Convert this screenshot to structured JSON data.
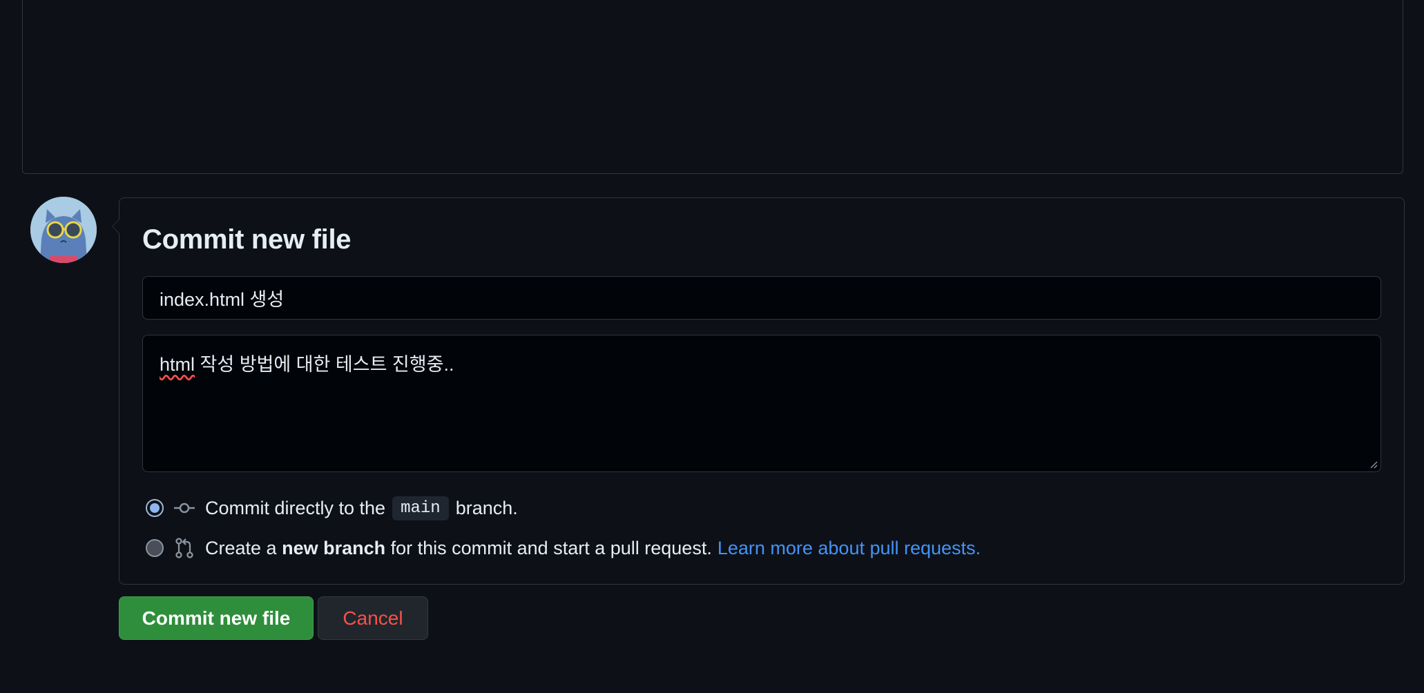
{
  "commit": {
    "title": "Commit new file",
    "summary_value": "index.html 생성",
    "description_value_word1": "html",
    "description_value_rest": " 작성 방법에 대한 테스트 진행중..",
    "options": {
      "direct": {
        "prefix": "Commit directly to the",
        "branch": "main",
        "suffix": "branch.",
        "selected": true
      },
      "new_branch": {
        "prefix": "Create a",
        "bold": "new branch",
        "suffix": "for this commit and start a pull request.",
        "link": "Learn more about pull requests.",
        "selected": false
      }
    }
  },
  "buttons": {
    "commit_label": "Commit new file",
    "cancel_label": "Cancel"
  },
  "colors": {
    "background": "#0d1117",
    "border": "#30363d",
    "primary_green": "#2f8e3c",
    "danger_red": "#f85149",
    "link_blue": "#4493f8"
  },
  "icons": {
    "direct": "git-commit-icon",
    "new_branch": "git-pull-request-icon"
  }
}
